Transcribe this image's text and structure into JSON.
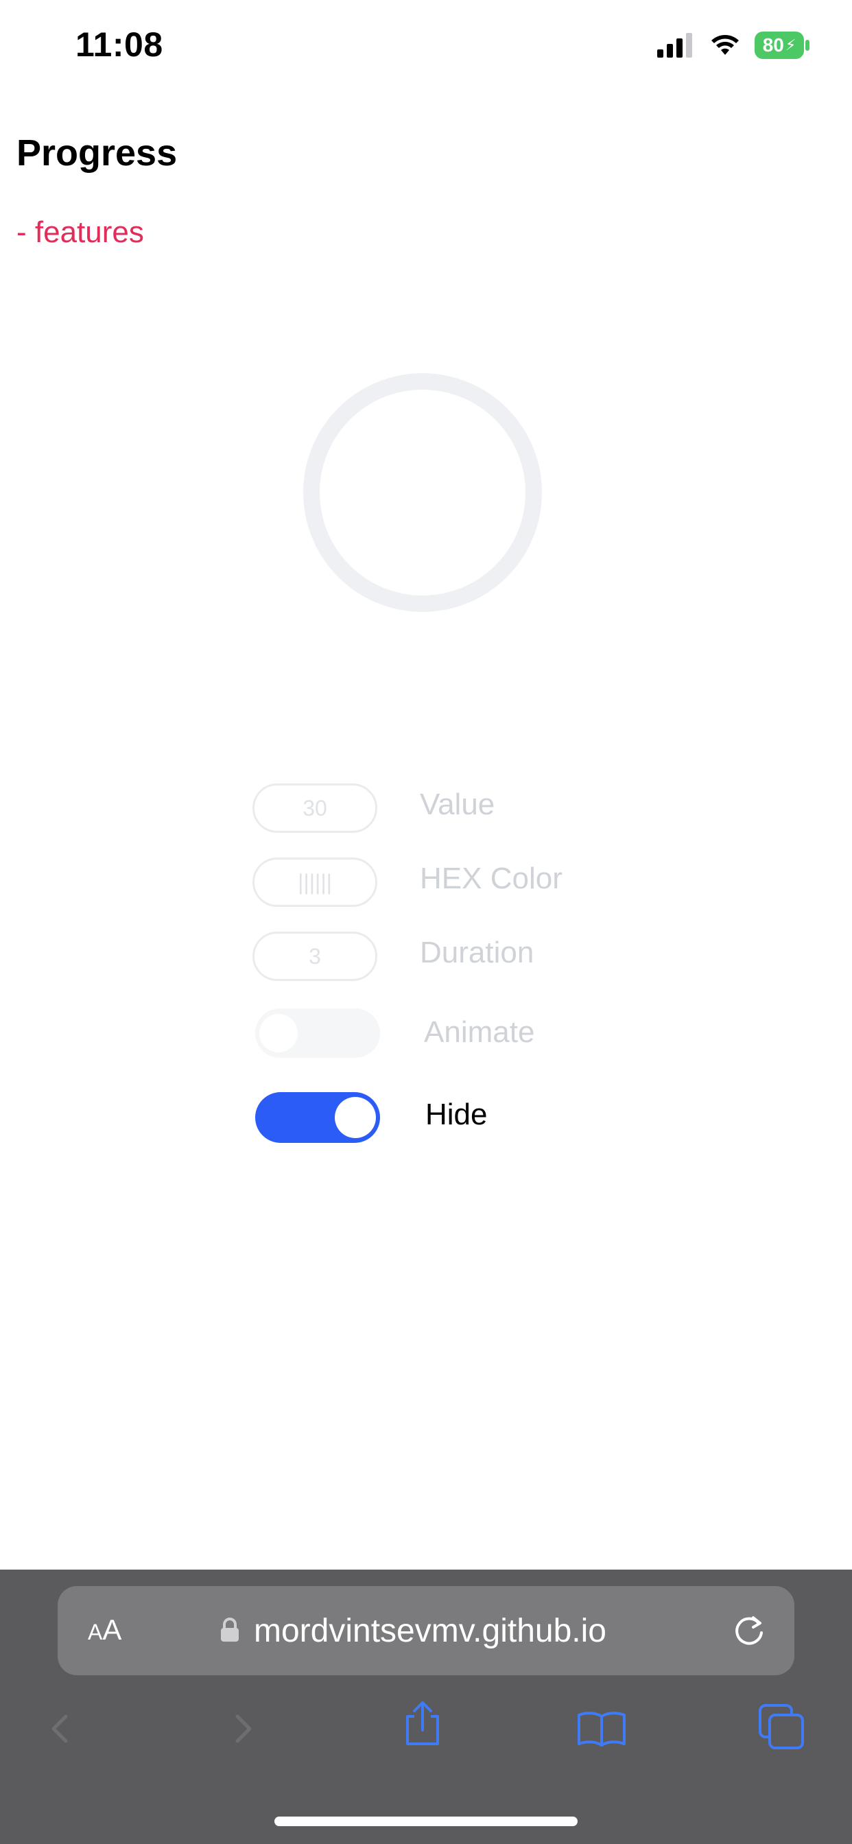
{
  "status_bar": {
    "time": "11:08",
    "battery_percent": "80"
  },
  "page": {
    "title": "Progress",
    "subtitle": "- features"
  },
  "progress": {
    "value_percent": 0,
    "track_color": "#eef0f3"
  },
  "controls": {
    "value": {
      "input_value": "30",
      "label": "Value"
    },
    "hex_color": {
      "input_value": "||||||",
      "label": "HEX Color"
    },
    "duration": {
      "input_value": "3",
      "label": "Duration"
    },
    "animate": {
      "label": "Animate",
      "on": false
    },
    "hide": {
      "label": "Hide",
      "on": true
    }
  },
  "colors": {
    "accent": "#2b5cf5",
    "subtitle": "#e02e5a",
    "battery": "#4cc964"
  },
  "browser": {
    "text_size_label_small": "A",
    "text_size_label_large": "A",
    "url": "mordvintsevmv.github.io",
    "icons": [
      "back-icon",
      "forward-icon",
      "share-icon",
      "bookmarks-icon",
      "tabs-icon",
      "reload-icon",
      "lock-icon"
    ]
  }
}
